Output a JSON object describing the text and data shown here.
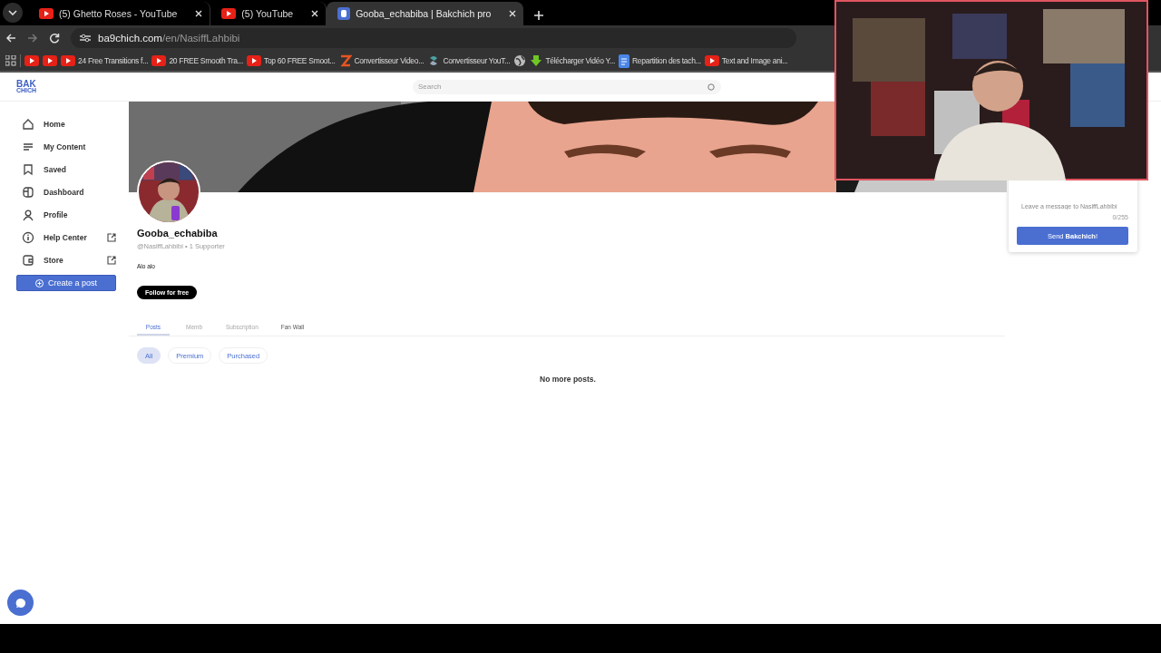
{
  "browser": {
    "tabs": [
      {
        "title": "(5) Ghetto Roses - YouTube",
        "kind": "youtube",
        "selected": false
      },
      {
        "title": "(5) YouTube",
        "kind": "youtube",
        "selected": false
      },
      {
        "title": "Gooba_echabiba | Bakchich pro",
        "kind": "site",
        "selected": true
      }
    ],
    "address": {
      "host": "ba9chich.com",
      "path": "/en/NasiffLahbibi"
    },
    "bookmarks": [
      {
        "kind": "youtube"
      },
      {
        "kind": "youtube"
      },
      {
        "label": "24 Free Transitions f...",
        "kind": "youtube"
      },
      {
        "label": "20 FREE Smooth Tra...",
        "kind": "youtube"
      },
      {
        "label": "Top 60 FREE Smoot...",
        "kind": "youtube"
      },
      {
        "label": "Convertisseur Video...",
        "kind": "zigzag"
      },
      {
        "label": "Convertisseur YouT...",
        "kind": "swirl"
      },
      {
        "kind": "globe"
      },
      {
        "label": "Télécharger Vidéo Y...",
        "kind": "download"
      },
      {
        "label": "Repartition des tach...",
        "kind": "doc"
      },
      {
        "label": "Text and Image ani...",
        "kind": "youtube"
      }
    ]
  },
  "site": {
    "logo": [
      "BAK",
      "CHICH"
    ],
    "search": {
      "placeholder": "Search"
    },
    "nav": [
      {
        "label": "Home",
        "kind": "home",
        "external": false
      },
      {
        "label": "My Content",
        "kind": "lines",
        "external": false
      },
      {
        "label": "Saved",
        "kind": "bookmark",
        "external": false
      },
      {
        "label": "Dashboard",
        "kind": "dashboard",
        "external": false
      },
      {
        "label": "Profile",
        "kind": "person",
        "external": false
      },
      {
        "label": "Help Center",
        "kind": "info",
        "external": true
      },
      {
        "label": "Store",
        "kind": "wallet",
        "external": true
      }
    ],
    "create_button": "Create a post",
    "profile": {
      "name": "Gooba_echabiba",
      "handle_line": "@NasiffLahbibi • 1 Supporter",
      "bio": "Alo alo",
      "follow_button": "Follow for free",
      "tabs": [
        {
          "label": "Posts",
          "selected": true,
          "disabled": false
        },
        {
          "label": "Memb",
          "selected": false,
          "disabled": true
        },
        {
          "label": "Subscription",
          "selected": false,
          "disabled": true
        },
        {
          "label": "Fan Wall",
          "selected": false,
          "disabled": false
        }
      ],
      "filters": [
        {
          "label": "All",
          "selected": true
        },
        {
          "label": "Premium",
          "selected": false
        },
        {
          "label": "Purchased",
          "selected": false
        }
      ],
      "empty_message": "No more posts."
    },
    "tip": {
      "message_placeholder": "Leave a message to NasiffLahbibi",
      "counter": "0/255",
      "send_button": "Send **Bakchich**!"
    }
  }
}
